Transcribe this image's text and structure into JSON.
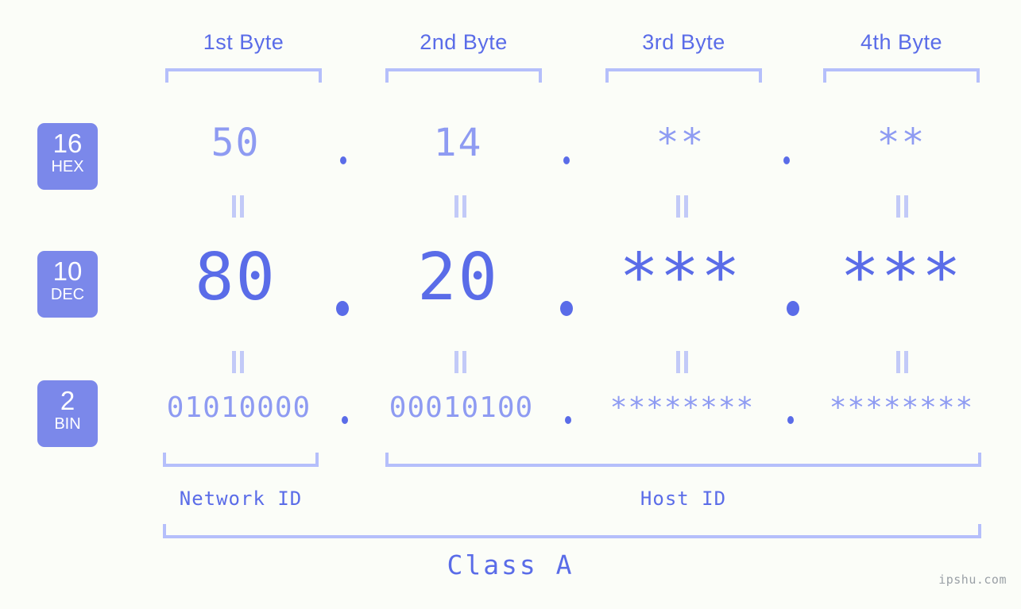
{
  "background_color": "#fbfdf8",
  "accent_color": "#5a6ce8",
  "accent_light_color": "#8e9bf2",
  "bracket_color": "#b5bffb",
  "badge_color": "#7b88ea",
  "headers": [
    {
      "label": "1st Byte"
    },
    {
      "label": "2nd Byte"
    },
    {
      "label": "3rd Byte"
    },
    {
      "label": "4th Byte"
    }
  ],
  "bases": [
    {
      "number": "16",
      "name": "HEX"
    },
    {
      "number": "10",
      "name": "DEC"
    },
    {
      "number": "2",
      "name": "BIN"
    }
  ],
  "rows": {
    "hex": {
      "base_number": "16",
      "base_name": "HEX",
      "values": [
        "50",
        "14",
        "**",
        "**"
      ]
    },
    "dec": {
      "base_number": "10",
      "base_name": "DEC",
      "values": [
        "80",
        "20",
        "***",
        "***"
      ]
    },
    "bin": {
      "base_number": "2",
      "base_name": "BIN",
      "values": [
        "01010000",
        "00010100",
        "********",
        "********"
      ]
    }
  },
  "separator": ".",
  "equals_glyph": "=",
  "segments": [
    {
      "label": "Network ID"
    },
    {
      "label": "Host ID"
    }
  ],
  "class": {
    "label": "Class A"
  },
  "watermark": "ipshu.com"
}
